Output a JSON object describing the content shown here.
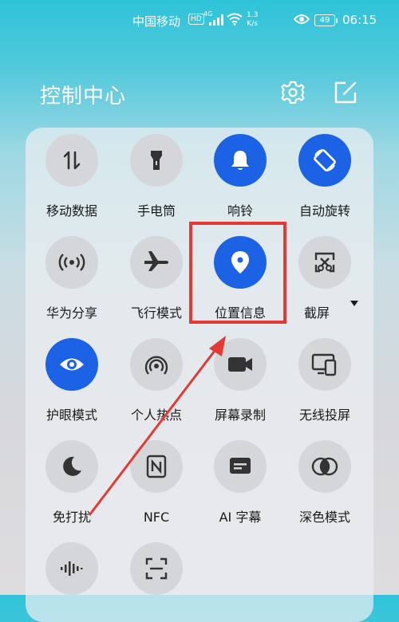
{
  "status_bar": {
    "carrier": "中国移动",
    "hd": "HD",
    "network": "4G",
    "speed_value": "1.3",
    "speed_unit": "K/s",
    "battery": "49",
    "time": "06:15"
  },
  "header": {
    "title": "控制中心"
  },
  "icons": {
    "settings": "gear-icon",
    "edit": "edit-icon"
  },
  "tiles": [
    {
      "label": "移动数据",
      "icon": "mobile-data-icon",
      "active": false
    },
    {
      "label": "手电筒",
      "icon": "flashlight-icon",
      "active": false
    },
    {
      "label": "响铃",
      "icon": "bell-icon",
      "active": true
    },
    {
      "label": "自动旋转",
      "icon": "auto-rotate-icon",
      "active": true
    },
    {
      "label": "华为分享",
      "icon": "huawei-share-icon",
      "active": false
    },
    {
      "label": "飞行模式",
      "icon": "airplane-icon",
      "active": false
    },
    {
      "label": "位置信息",
      "icon": "location-icon",
      "active": true
    },
    {
      "label": "截屏",
      "icon": "screenshot-icon",
      "active": false
    },
    {
      "label": "护眼模式",
      "icon": "eye-comfort-icon",
      "active": true
    },
    {
      "label": "个人热点",
      "icon": "hotspot-icon",
      "active": false
    },
    {
      "label": "屏幕录制",
      "icon": "screen-record-icon",
      "active": false
    },
    {
      "label": "无线投屏",
      "icon": "wireless-projection-icon",
      "active": false
    },
    {
      "label": "免打扰",
      "icon": "do-not-disturb-icon",
      "active": false
    },
    {
      "label": "NFC",
      "icon": "nfc-icon",
      "active": false
    },
    {
      "label": "AI 字幕",
      "icon": "ai-subtitles-icon",
      "active": false
    },
    {
      "label": "深色模式",
      "icon": "dark-mode-icon",
      "active": false
    },
    {
      "label": "",
      "icon": "sound-wave-icon",
      "active": false
    },
    {
      "label": "",
      "icon": "scan-icon",
      "active": false
    }
  ],
  "colors": {
    "active": "#1b63e4",
    "inactive": "#d4d6da",
    "annotation": "#e53935"
  }
}
